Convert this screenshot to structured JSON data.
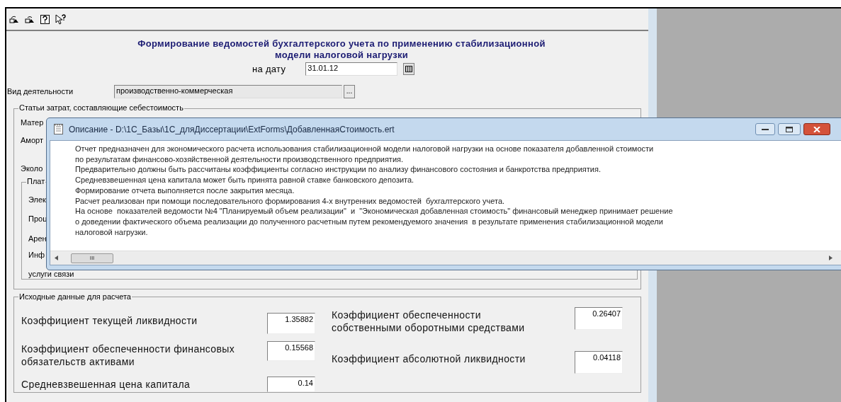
{
  "form": {
    "title_lines": [
      "Формирование ведомостей бухгалтерского учета по применению стабилизационной",
      "модели налоговой нагрузки"
    ],
    "date": {
      "label": "на дату",
      "value": "31.01.12"
    },
    "activity": {
      "label": "Вид деятельности",
      "value": "производственно-коммерческая",
      "button": "..."
    },
    "costs_group": {
      "legend": "Статьи затрат, составляющие себестоимость",
      "labels": [
        "Матер",
        "Аморт",
        "Эколо"
      ],
      "sub_group": {
        "legend": "Плат",
        "labels": [
          "Элек",
          "Проц",
          "Арен",
          "Инф",
          "услуги связи"
        ]
      }
    },
    "input_group": {
      "legend": "Исходные данные для расчета",
      "left": [
        {
          "label": "Коэффициент текущей ликвидности",
          "value": "1.35882"
        },
        {
          "label": "Коэффициент обеспеченности финансовых обязательств активами",
          "value": "0.15568"
        },
        {
          "label": "Средневзвешенная цена капитала",
          "value": "0.14"
        }
      ],
      "right": [
        {
          "label": "Коэффициент обеспеченности собственными оборотными средствами",
          "value": "0.26407"
        },
        {
          "label": "Коэффициент абсолютной ликвидности",
          "value": "0.04118"
        }
      ]
    }
  },
  "dialog": {
    "title": "Описание - D:\\1С_Базы\\1С_дляДиссертации\\ExtForms\\ДобавленнаяСтоимость.ert",
    "lines": [
      "Отчет предназначен для экономического расчета использования стабилизационной модели налоговой нагрузки на основе показателя добавленной стоимости",
      "по результатам финансово-хозяйственной деятельности производственного предприятия.",
      "Предварительно должны быть рассчитаны коэффициенты согласно инструкции по анализу финансового состояния и банкротства предприятия.",
      "Средневзвешенная цена капитала может быть принята равной ставке банковского депозита.",
      "Формирование отчета выполняется после закрытия месяца.",
      "Расчет реализован при помощи последовательного формирования 4-х внутренних ведомостей  бухгалтерского учета.",
      "На основе  показателей ведомости №4 \"Планируемый объем реализации\"  и  \"Экономическая добавленная стоимость\" финансовый менеджер принимает решение",
      "о доведении фактического объема реализации до полученного расчетным путем рекомендуемого значения  в результате применения стабилизационной модели",
      "налоговой нагрузки."
    ],
    "scroll_thumb": "III"
  }
}
